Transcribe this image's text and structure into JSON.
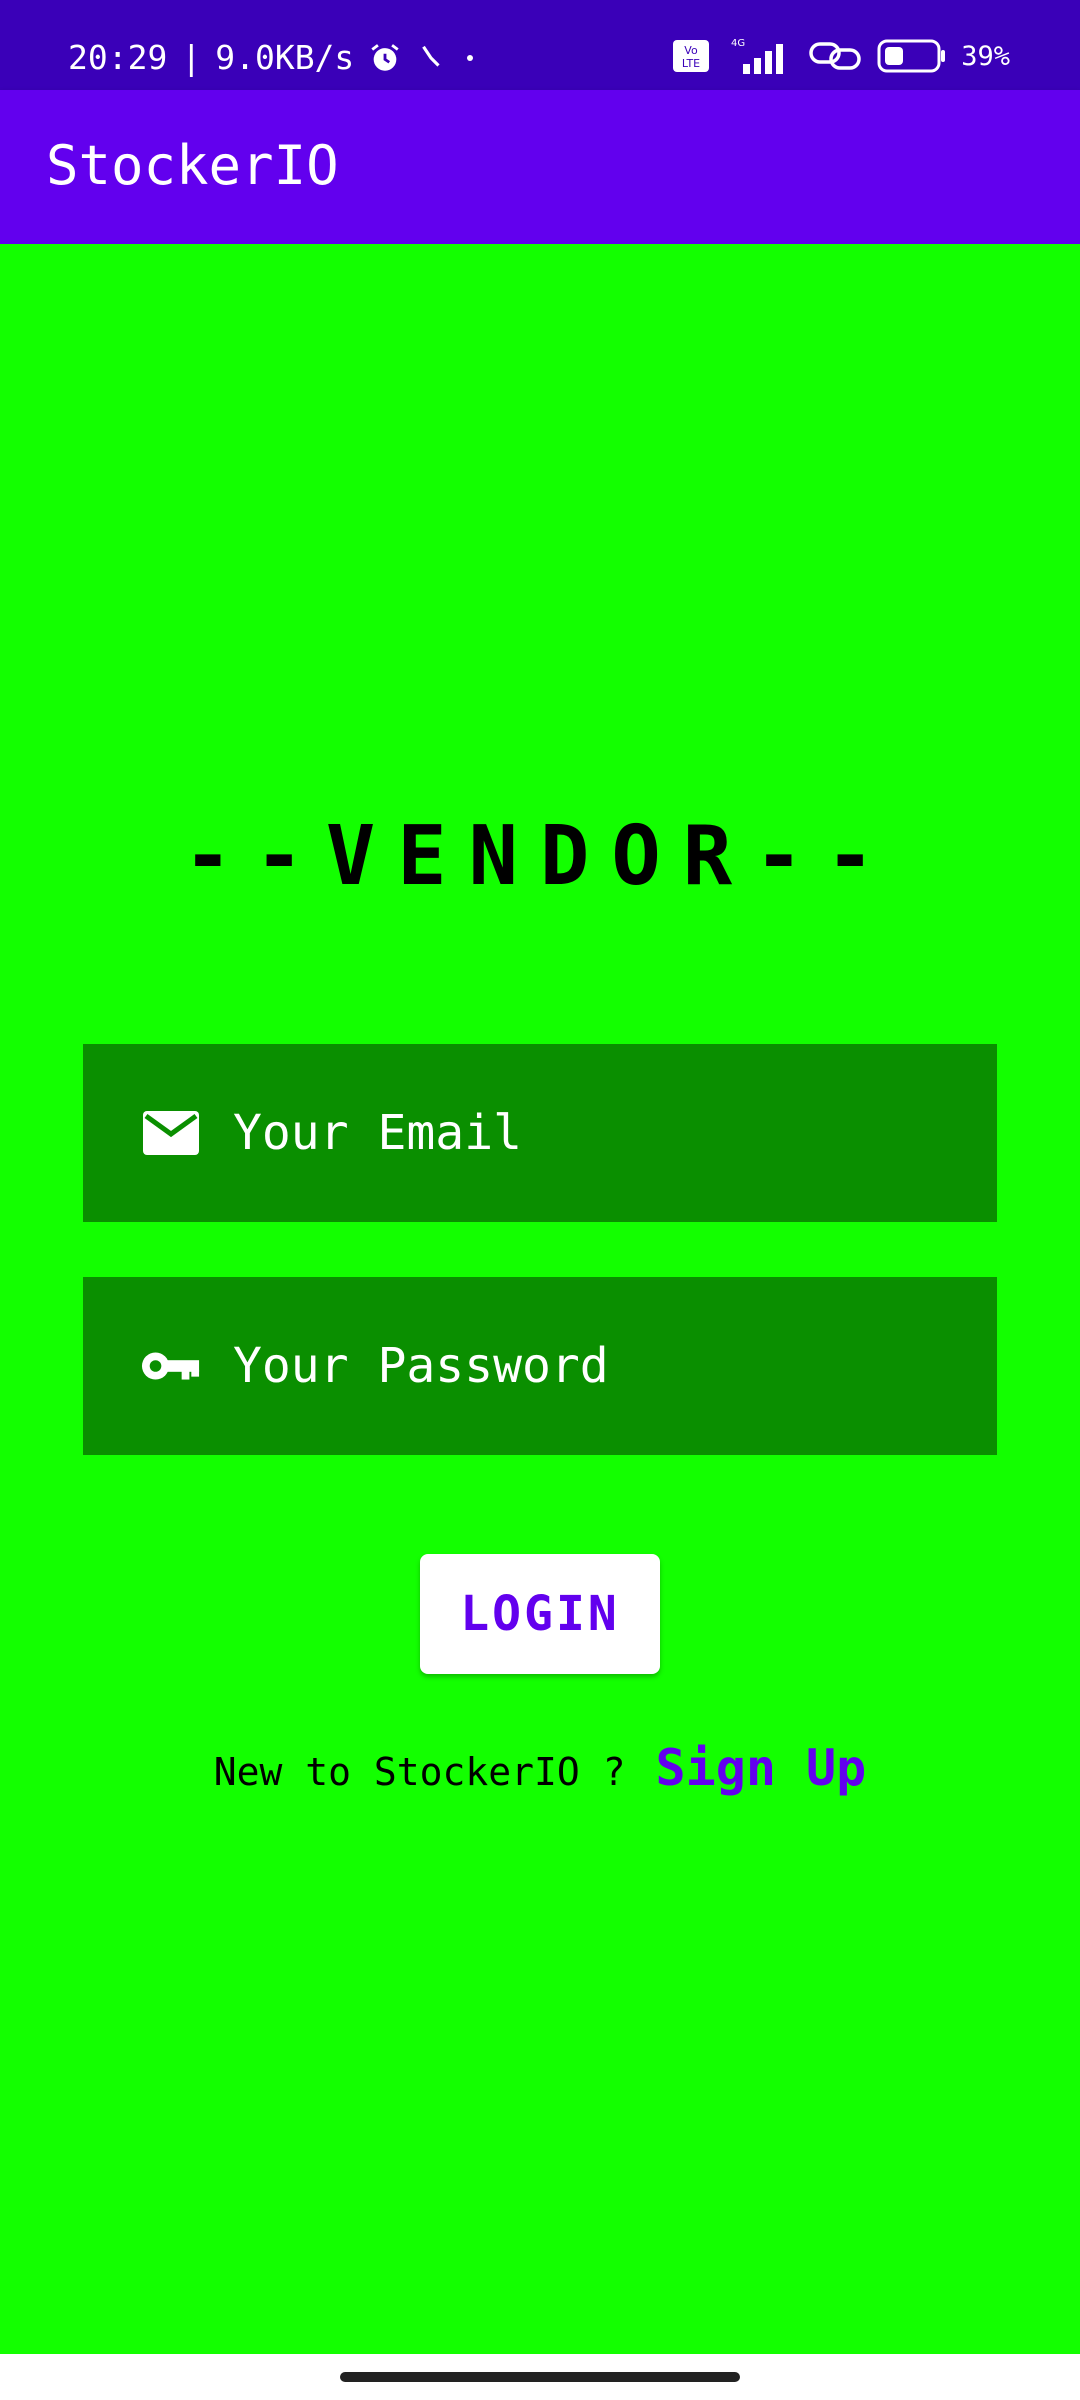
{
  "status_bar": {
    "time": "20:29",
    "separator": "|",
    "network_speed": "9.0KB/s",
    "battery_percent": "39%",
    "network_type": "4G",
    "icons": [
      "alarm-icon",
      "bluetooth-icon",
      "dot-icon",
      "volte-icon",
      "signal-icon",
      "link-icon",
      "battery-icon"
    ]
  },
  "app_bar": {
    "title": "StockerIO"
  },
  "login": {
    "heading": "--VENDOR--",
    "email_placeholder": "Your Email",
    "password_placeholder": "Your Password",
    "login_label": "LOGIN",
    "signup_prompt": "New to StockerIO ?",
    "signup_link": "Sign Up"
  },
  "colors": {
    "status_bar": "#3a00b8",
    "app_bar": "#6200ee",
    "background": "#13ff00",
    "field_background": "#0a8f00",
    "accent": "#6200ee"
  }
}
